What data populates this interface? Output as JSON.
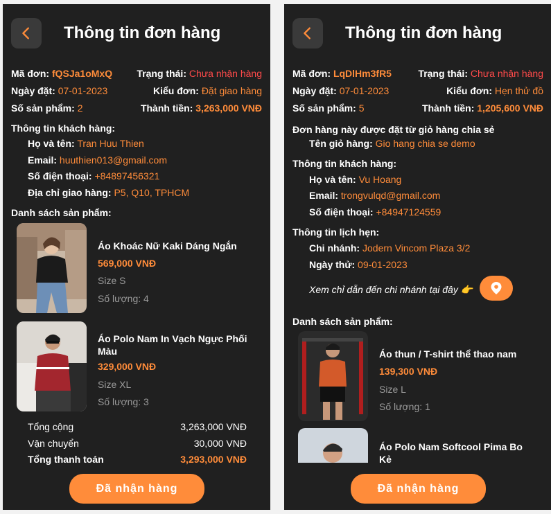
{
  "colors": {
    "background": "#202020",
    "accent": "#ff8c3a",
    "status_red": "#ff4a4a",
    "muted": "#9a9a9a",
    "back_button": "#3a3a3a"
  },
  "left": {
    "title": "Thông tin đơn hàng",
    "order_code_label": "Mã đơn:",
    "order_code": "fQSJa1oMxQ",
    "status_label": "Trạng thái:",
    "status": "Chưa nhận hàng",
    "order_date_label": "Ngày đặt:",
    "order_date": "07-01-2023",
    "order_type_label": "Kiểu đơn:",
    "order_type": "Đặt giao hàng",
    "product_count_label": "Số sản phẩm:",
    "product_count": "2",
    "total_label": "Thành tiền:",
    "total": "3,263,000 VNĐ",
    "customer_section": "Thông tin khách hàng:",
    "name_label": "Họ và tên:",
    "name": "Tran Huu Thien",
    "email_label": "Email:",
    "email": "huuthien013@gmail.com",
    "phone_label": "Số điện thoại:",
    "phone": "+84897456321",
    "address_label": "Địa chỉ giao hàng:",
    "address": "P5, Q10, TPHCM",
    "products_section": "Danh sách sản phẩm:",
    "products": [
      {
        "name": "Áo Khoác Nữ Kaki Dáng Ngắn",
        "price": "569,000 VNĐ",
        "size": "Size S",
        "qty": "Số lượng: 4"
      },
      {
        "name": "Áo Polo Nam In Vạch Ngực Phối Màu",
        "price": "329,000 VNĐ",
        "size": "Size XL",
        "qty": "Số lượng: 3"
      }
    ],
    "summary": {
      "subtotal_label": "Tổng cộng",
      "subtotal": "3,263,000 VNĐ",
      "shipping_label": "Vận chuyển",
      "shipping": "30,000 VNĐ",
      "grand_label": "Tổng thanh toán",
      "grand": "3,293,000 VNĐ"
    },
    "button": "Đã nhận hàng"
  },
  "right": {
    "title": "Thông tin đơn hàng",
    "order_code_label": "Mã đơn:",
    "order_code": "LqDlHm3fR5",
    "status_label": "Trạng thái:",
    "status": "Chưa nhận hàng",
    "order_date_label": "Ngày đặt:",
    "order_date": "07-01-2023",
    "order_type_label": "Kiểu đơn:",
    "order_type": "Hẹn thử đồ",
    "product_count_label": "Số sản phẩm:",
    "product_count": "5",
    "total_label": "Thành tiền:",
    "total": "1,205,600 VNĐ",
    "shared_cart_note": "Đơn hàng này được đặt từ giỏ hàng chia sẻ",
    "cart_name_label": "Tên giỏ hàng:",
    "cart_name": "Gio hang chia se demo",
    "customer_section": "Thông tin khách hàng:",
    "name_label": "Họ và tên:",
    "name": "Vu Hoang",
    "email_label": "Email:",
    "email": "trongvulqd@gmail.com",
    "phone_label": "Số điện thoại:",
    "phone": "+84947124559",
    "appointment_section": "Thông tin lịch hẹn:",
    "branch_label": "Chi nhánh:",
    "branch": "Jodern Vincom Plaza 3/2",
    "trial_date_label": "Ngày thử:",
    "trial_date": "09-01-2023",
    "directions_text": "Xem chỉ dẫn đến chi nhánh tại đây 👉",
    "products_section": "Danh sách sản phẩm:",
    "products": [
      {
        "name": "Áo thun / T-shirt thể thao nam",
        "price": "139,300 VNĐ",
        "size": "Size L",
        "qty": "Số lượng: 1"
      },
      {
        "name": "Áo Polo Nam Softcool Pima Bo Kẻ"
      }
    ],
    "button": "Đã nhận hàng"
  }
}
